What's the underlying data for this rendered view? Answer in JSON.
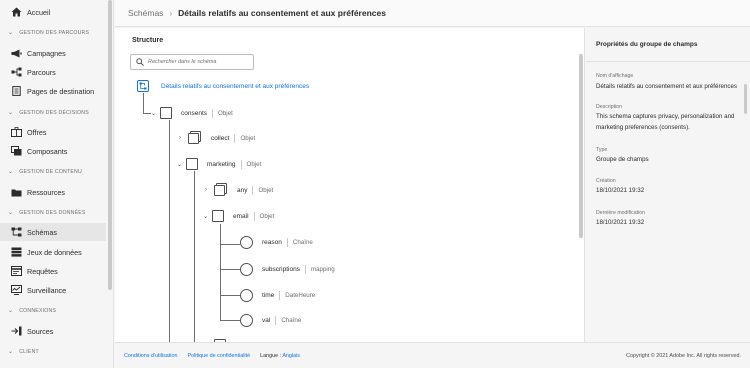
{
  "sidebar": {
    "home": "Accueil",
    "sections": [
      {
        "label": "Gestion des parcours",
        "items": [
          {
            "label": "Campagnes",
            "icon": "megaphone-icon"
          },
          {
            "label": "Parcours",
            "icon": "journey-icon"
          },
          {
            "label": "Pages de destination",
            "icon": "page-icon"
          }
        ]
      },
      {
        "label": "Gestion des décisions",
        "items": [
          {
            "label": "Offres",
            "icon": "offer-icon"
          },
          {
            "label": "Composants",
            "icon": "components-icon"
          }
        ]
      },
      {
        "label": "Gestion de contenu",
        "items": [
          {
            "label": "Ressources",
            "icon": "folder-icon"
          }
        ]
      },
      {
        "label": "Gestion des données",
        "items": [
          {
            "label": "Schémas",
            "icon": "schema-icon"
          },
          {
            "label": "Jeux de données",
            "icon": "datasets-icon"
          },
          {
            "label": "Requêtes",
            "icon": "queries-icon"
          },
          {
            "label": "Surveillance",
            "icon": "monitoring-icon"
          }
        ]
      },
      {
        "label": "Connexions",
        "items": [
          {
            "label": "Sources",
            "icon": "sources-icon"
          }
        ]
      },
      {
        "label": "Client",
        "items": []
      }
    ],
    "active": "Schémas"
  },
  "header": {
    "crumb_parent": "Schémas",
    "crumb_current": "Détails relatifs au consentement et aux préférences"
  },
  "structure": {
    "title": "Structure",
    "search_placeholder": "Rechercher dans le schéma",
    "root_label": "Détails relatifs au consentement et aux préférences",
    "nodes": [
      {
        "name": "consents",
        "type": "Objet"
      },
      {
        "name": "collect",
        "type": "Objet"
      },
      {
        "name": "marketing",
        "type": "Objet"
      },
      {
        "name": "any",
        "type": "Objet"
      },
      {
        "name": "email",
        "type": "Objet"
      },
      {
        "name": "reason",
        "type": "Chaîne"
      },
      {
        "name": "subscriptions",
        "type": "mapping"
      },
      {
        "name": "time",
        "type": "DateHeure"
      },
      {
        "name": "val",
        "type": "Chaîne"
      }
    ]
  },
  "properties": {
    "title": "Propriétés du groupe de champs",
    "display_name_label": "Nom d'affichage",
    "display_name_value": "Détails relatifs au consentement et aux préférences",
    "description_label": "Description",
    "description_value": "This schema captures privacy, personalization and marketing preferences (consents).",
    "type_label": "Type",
    "type_value": "Groupe de champs",
    "created_label": "Création",
    "created_value": "18/10/2021 19:32",
    "modified_label": "Dernière modification",
    "modified_value": "18/10/2021 19:32"
  },
  "footer": {
    "terms": "Conditions d'utilisation",
    "privacy": "Politique de confidentialité",
    "lang_label": "Langue :",
    "lang_value": "Anglais",
    "copyright": "Copyright © 2021 Adobe Inc. All rights reserved."
  },
  "colors": {
    "accent": "#1473e6",
    "active_bg": "#e6e6e6"
  }
}
